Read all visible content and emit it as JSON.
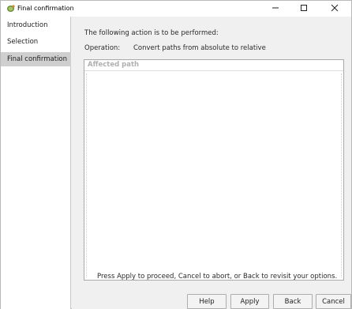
{
  "window": {
    "title": "Final confirmation",
    "icons": {
      "app": "tortoise-app-icon",
      "minimize": "minimize-icon",
      "maximize": "maximize-icon",
      "close": "close-icon"
    }
  },
  "sidebar": {
    "items": [
      {
        "label": "Introduction",
        "active": false
      },
      {
        "label": "Selection",
        "active": false
      },
      {
        "label": "Final confirmation",
        "active": true
      }
    ]
  },
  "main": {
    "intro_text": "The following action is to be performed:",
    "operation_label": "Operation:",
    "operation_value": "Convert paths from absolute to relative",
    "table": {
      "header": "Affected path",
      "rows": []
    },
    "instructions": "Press Apply to proceed, Cancel to abort, or Back to revisit your options."
  },
  "buttons": {
    "help": "Help",
    "apply": "Apply",
    "back": "Back",
    "cancel": "Cancel"
  },
  "colors": {
    "sidebar_active_bg": "#cfcfcf",
    "window_bg": "#f0f0f0",
    "header_text": "#b0b0b0"
  }
}
